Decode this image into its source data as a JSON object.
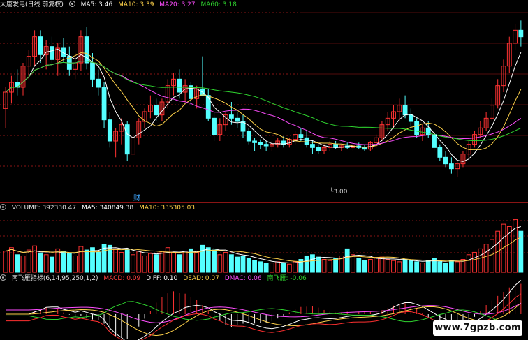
{
  "kline": {
    "title": "大唐发电(日线 前复权)",
    "ma5": "MA5: 3.46",
    "ma10": "MA10: 3.39",
    "ma20": "MA20: 3.27",
    "ma60": "MA60: 3.18",
    "low_marker": "3.00",
    "event_marker": "财"
  },
  "volume": {
    "label": "VOLUME: 392330.47",
    "ma5": "MA5: 340849.38",
    "ma10": "MA10: 335305.03"
  },
  "indicator": {
    "name": "南飞雁指标(6,14,95,250,1,2)",
    "macd": "MACD: 0.09",
    "diff": "DIFF: 0.10",
    "dead": "DEAD: 0.07",
    "dmac": "DMAC: 0.06",
    "nfy": "南飞雁: -0.06"
  },
  "watermark": "www.7gpzb.com",
  "colors": {
    "up": "#ff3232",
    "down": "#54ffff",
    "ma5": "#ffffff",
    "ma10": "#ffd24a",
    "ma20": "#ff4dff",
    "ma60": "#2fd42f",
    "grid": "#8a1414"
  },
  "chart_data": {
    "type": "candlestick",
    "series_name": "大唐发电",
    "candles": [
      [
        3.42,
        3.55,
        3.3,
        3.52
      ],
      [
        3.52,
        3.62,
        3.45,
        3.58
      ],
      [
        3.58,
        3.66,
        3.5,
        3.55
      ],
      [
        3.55,
        3.7,
        3.5,
        3.68
      ],
      [
        3.68,
        3.78,
        3.6,
        3.74
      ],
      [
        3.74,
        3.9,
        3.68,
        3.86
      ],
      [
        3.86,
        3.9,
        3.7,
        3.75
      ],
      [
        3.75,
        3.84,
        3.66,
        3.8
      ],
      [
        3.8,
        3.86,
        3.7,
        3.72
      ],
      [
        3.72,
        3.82,
        3.62,
        3.79
      ],
      [
        3.79,
        3.85,
        3.7,
        3.74
      ],
      [
        3.74,
        3.8,
        3.62,
        3.66
      ],
      [
        3.66,
        3.76,
        3.6,
        3.7
      ],
      [
        3.7,
        3.9,
        3.65,
        3.86
      ],
      [
        3.86,
        3.92,
        3.66,
        3.7
      ],
      [
        3.7,
        3.76,
        3.55,
        3.6
      ],
      [
        3.6,
        3.66,
        3.5,
        3.55
      ],
      [
        3.55,
        3.58,
        3.3,
        3.35
      ],
      [
        3.35,
        3.4,
        3.18,
        3.22
      ],
      [
        3.22,
        3.3,
        3.12,
        3.28
      ],
      [
        3.28,
        3.36,
        3.2,
        3.32
      ],
      [
        3.32,
        3.34,
        3.1,
        3.14
      ],
      [
        3.14,
        3.26,
        3.08,
        3.24
      ],
      [
        3.24,
        3.36,
        3.2,
        3.34
      ],
      [
        3.34,
        3.42,
        3.3,
        3.4
      ],
      [
        3.4,
        3.5,
        3.36,
        3.44
      ],
      [
        3.44,
        3.48,
        3.34,
        3.38
      ],
      [
        3.38,
        3.48,
        3.34,
        3.46
      ],
      [
        3.46,
        3.6,
        3.42,
        3.56
      ],
      [
        3.56,
        3.64,
        3.5,
        3.6
      ],
      [
        3.6,
        3.66,
        3.48,
        3.52
      ],
      [
        3.52,
        3.6,
        3.46,
        3.56
      ],
      [
        3.56,
        3.58,
        3.44,
        3.48
      ],
      [
        3.48,
        3.56,
        3.42,
        3.54
      ],
      [
        3.54,
        3.74,
        3.5,
        3.5
      ],
      [
        3.5,
        3.54,
        3.34,
        3.36
      ],
      [
        3.36,
        3.4,
        3.22,
        3.26
      ],
      [
        3.26,
        3.36,
        3.22,
        3.32
      ],
      [
        3.32,
        3.4,
        3.28,
        3.38
      ],
      [
        3.38,
        3.46,
        3.32,
        3.36
      ],
      [
        3.36,
        3.4,
        3.3,
        3.34
      ],
      [
        3.34,
        3.38,
        3.24,
        3.28
      ],
      [
        3.28,
        3.3,
        3.2,
        3.22
      ],
      [
        3.22,
        3.24,
        3.16,
        3.21
      ],
      [
        3.21,
        3.23,
        3.17,
        3.2
      ],
      [
        3.2,
        3.22,
        3.16,
        3.19
      ],
      [
        3.19,
        3.22,
        3.16,
        3.2
      ],
      [
        3.2,
        3.24,
        3.18,
        3.22
      ],
      [
        3.22,
        3.25,
        3.18,
        3.2
      ],
      [
        3.2,
        3.24,
        3.18,
        3.23
      ],
      [
        3.23,
        3.28,
        3.2,
        3.26
      ],
      [
        3.26,
        3.3,
        3.22,
        3.24
      ],
      [
        3.24,
        3.28,
        3.18,
        3.2
      ],
      [
        3.2,
        3.22,
        3.14,
        3.18
      ],
      [
        3.18,
        3.2,
        3.14,
        3.16
      ],
      [
        3.16,
        3.2,
        3.14,
        3.18
      ],
      [
        3.18,
        3.22,
        3.16,
        3.2
      ],
      [
        3.2,
        3.22,
        3.17,
        3.18
      ],
      [
        3.18,
        3.2,
        3.16,
        3.19
      ],
      [
        3.19,
        3.21,
        3.17,
        3.18
      ],
      [
        3.18,
        3.2,
        3.16,
        3.19
      ],
      [
        3.19,
        3.21,
        3.17,
        3.18
      ],
      [
        3.18,
        3.2,
        3.16,
        3.17
      ],
      [
        3.17,
        3.22,
        3.16,
        3.21
      ],
      [
        3.21,
        3.26,
        3.18,
        3.24
      ],
      [
        3.24,
        3.34,
        3.22,
        3.32
      ],
      [
        3.32,
        3.4,
        3.28,
        3.36
      ],
      [
        3.36,
        3.44,
        3.3,
        3.4
      ],
      [
        3.4,
        3.48,
        3.34,
        3.44
      ],
      [
        3.44,
        3.5,
        3.36,
        3.38
      ],
      [
        3.38,
        3.42,
        3.3,
        3.34
      ],
      [
        3.34,
        3.36,
        3.24,
        3.26
      ],
      [
        3.26,
        3.32,
        3.22,
        3.3
      ],
      [
        3.3,
        3.34,
        3.24,
        3.26
      ],
      [
        3.26,
        3.28,
        3.16,
        3.18
      ],
      [
        3.18,
        3.2,
        3.1,
        3.12
      ],
      [
        3.12,
        3.16,
        3.06,
        3.08
      ],
      [
        3.08,
        3.12,
        3.02,
        3.05
      ],
      [
        3.05,
        3.1,
        3.0,
        3.08
      ],
      [
        3.08,
        3.16,
        3.06,
        3.14
      ],
      [
        3.14,
        3.22,
        3.12,
        3.2
      ],
      [
        3.2,
        3.28,
        3.18,
        3.26
      ],
      [
        3.26,
        3.34,
        3.24,
        3.3
      ],
      [
        3.3,
        3.4,
        3.28,
        3.36
      ],
      [
        3.36,
        3.48,
        3.34,
        3.44
      ],
      [
        3.44,
        3.6,
        3.42,
        3.56
      ],
      [
        3.56,
        3.72,
        3.52,
        3.68
      ],
      [
        3.68,
        3.86,
        3.64,
        3.82
      ],
      [
        3.82,
        3.94,
        3.78,
        3.9
      ],
      [
        3.9,
        3.96,
        3.8,
        3.86
      ]
    ],
    "volume": [
      0.36,
      0.42,
      0.3,
      0.28,
      0.38,
      0.45,
      0.33,
      0.3,
      0.26,
      0.4,
      0.36,
      0.32,
      0.28,
      0.44,
      0.38,
      0.42,
      0.34,
      0.48,
      0.46,
      0.4,
      0.34,
      0.38,
      0.3,
      0.36,
      0.28,
      0.32,
      0.3,
      0.36,
      0.42,
      0.34,
      0.3,
      0.36,
      0.4,
      0.34,
      0.46,
      0.42,
      0.38,
      0.3,
      0.34,
      0.3,
      0.26,
      0.28,
      0.24,
      0.2,
      0.18,
      0.16,
      0.16,
      0.18,
      0.16,
      0.14,
      0.18,
      0.22,
      0.28,
      0.3,
      0.26,
      0.22,
      0.2,
      0.24,
      0.28,
      0.4,
      0.3,
      0.24,
      0.2,
      0.22,
      0.24,
      0.26,
      0.22,
      0.2,
      0.18,
      0.22,
      0.2,
      0.18,
      0.16,
      0.2,
      0.24,
      0.18,
      0.16,
      0.2,
      0.18,
      0.22,
      0.3,
      0.34,
      0.4,
      0.48,
      0.56,
      0.7,
      0.82,
      0.78,
      0.9,
      0.7
    ]
  }
}
